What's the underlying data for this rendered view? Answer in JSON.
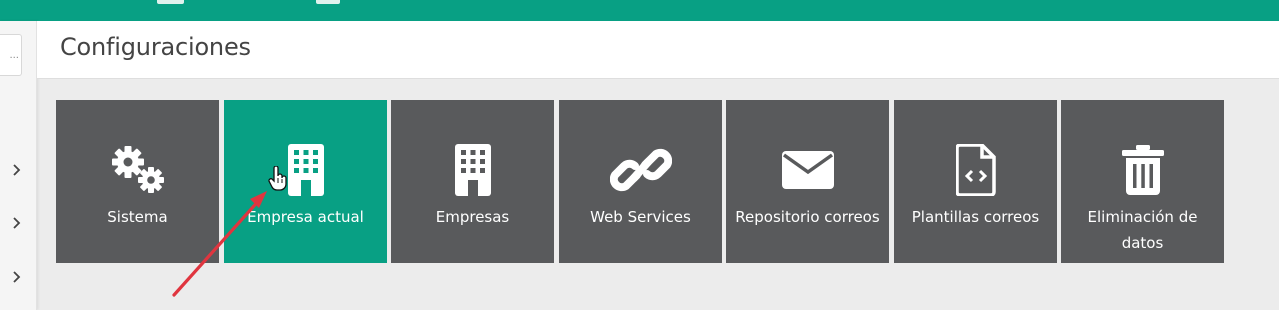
{
  "header": {
    "title": "Configuraciones"
  },
  "sidebar": {
    "search_hint": "...",
    "chevrons": [
      "chevron-right-icon",
      "chevron-right-icon",
      "chevron-right-icon"
    ]
  },
  "tiles": [
    {
      "label": "Sistema",
      "icon": "gears-icon",
      "active": false
    },
    {
      "label": "Empresa actual",
      "icon": "building-icon",
      "active": true
    },
    {
      "label": "Empresas",
      "icon": "building-icon",
      "active": false
    },
    {
      "label": "Web Services",
      "icon": "link-icon",
      "active": false
    },
    {
      "label": "Repositorio correos",
      "icon": "envelope-icon",
      "active": false
    },
    {
      "label": "Plantillas correos",
      "icon": "code-file-icon",
      "active": false
    },
    {
      "label": "Eliminación de datos",
      "icon": "trash-icon",
      "active": false
    }
  ],
  "colors": {
    "accent": "#08a084",
    "tile": "#595a5c",
    "annotation_arrow": "#e0353f"
  }
}
